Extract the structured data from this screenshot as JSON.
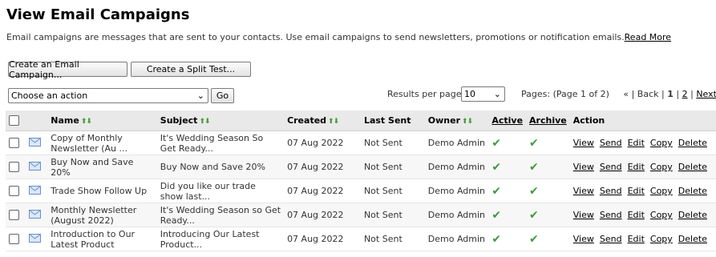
{
  "page": {
    "title": "View Email Campaigns",
    "intro": "Email campaigns are messages that are sent to your contacts. Use email campaigns to send newsletters, promotions or notification emails.",
    "read_more": "Read More"
  },
  "toolbar": {
    "create_campaign": "Create an Email Campaign...",
    "create_split": "Create a Split Test...",
    "action_select": "Choose an action",
    "go": "Go",
    "results_label": "Results per page:",
    "results_value": "10",
    "pages_label": "Pages: (Page 1 of 2)",
    "pager_prefix": "« |",
    "back": "Back",
    "pager_sep1": "|",
    "page1": "1",
    "pager_sep2": "|",
    "page2": "2",
    "pager_sep3": "|",
    "next": "Next",
    "pager_sep4": "|",
    "last": "»"
  },
  "table": {
    "headers": {
      "name": "Name",
      "subject": "Subject",
      "created": "Created",
      "last_sent": "Last Sent",
      "owner": "Owner",
      "active": "Active",
      "archive": "Archive",
      "action": "Action"
    },
    "action_labels": {
      "view": "View",
      "send": "Send",
      "edit": "Edit",
      "copy": "Copy",
      "delete": "Delete"
    },
    "rows": [
      {
        "name": "Copy of Monthly Newsletter (Au ...",
        "subject": "It's Wedding Season So Get Ready...",
        "created": "07 Aug 2022",
        "last_sent": "Not Sent",
        "owner": "Demo Admin"
      },
      {
        "name": "Buy Now and Save 20%",
        "subject": "Buy Now and Save 20%",
        "created": "07 Aug 2022",
        "last_sent": "Not Sent",
        "owner": "Demo Admin"
      },
      {
        "name": "Trade Show Follow Up",
        "subject": "Did you like our trade show last...",
        "created": "07 Aug 2022",
        "last_sent": "Not Sent",
        "owner": "Demo Admin"
      },
      {
        "name": "Monthly Newsletter (August 2022)",
        "subject": "It's Wedding Season so Get Ready...",
        "created": "07 Aug 2022",
        "last_sent": "Not Sent",
        "owner": "Demo Admin"
      },
      {
        "name": "Introduction to Our Latest Product",
        "subject": "Introducing Our Latest Product...",
        "created": "07 Aug 2022",
        "last_sent": "Not Sent",
        "owner": "Demo Admin"
      }
    ]
  },
  "colors": {
    "checkmark": "#3f9a3f",
    "sort_arrows": "#4a9a3a",
    "header_bg": "#e9e9e9",
    "envelope": "#6a8fc7"
  }
}
